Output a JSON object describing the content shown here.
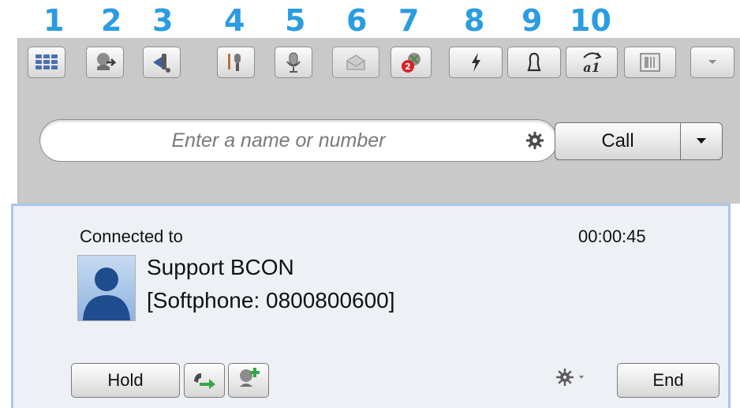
{
  "callout_numbers": [
    "1",
    "2",
    "3",
    "4",
    "5",
    "6",
    "7",
    "8",
    "9",
    "10"
  ],
  "toolbar": {
    "buttons": [
      {
        "icon": "dialpad-icon"
      },
      {
        "icon": "transfer-icon"
      },
      {
        "icon": "announce-icon"
      },
      {
        "icon": "record-icon"
      },
      {
        "icon": "microphone-icon"
      },
      {
        "icon": "voicemail-icon"
      },
      {
        "icon": "missed-calls-icon",
        "badge": "2"
      },
      {
        "icon": "lightning-icon"
      },
      {
        "icon": "person-icon"
      },
      {
        "icon": "text-format-icon",
        "label": "a1"
      },
      {
        "icon": "layout-icon"
      },
      {
        "icon": "chevron-down-icon"
      }
    ]
  },
  "search": {
    "placeholder": "Enter a name or number"
  },
  "call": {
    "label": "Call"
  },
  "active_call": {
    "status_label": "Connected to",
    "timer": "00:00:45",
    "name": "Support BCON",
    "detail": "[Softphone: 0800800600]"
  },
  "controls": {
    "hold_label": "Hold",
    "end_label": "End"
  },
  "colors": {
    "callout_blue": "#2a9ce3",
    "panel_border": "#a9c7ee",
    "missed_badge": "#d8232a",
    "transfer_green": "#3aa444"
  }
}
